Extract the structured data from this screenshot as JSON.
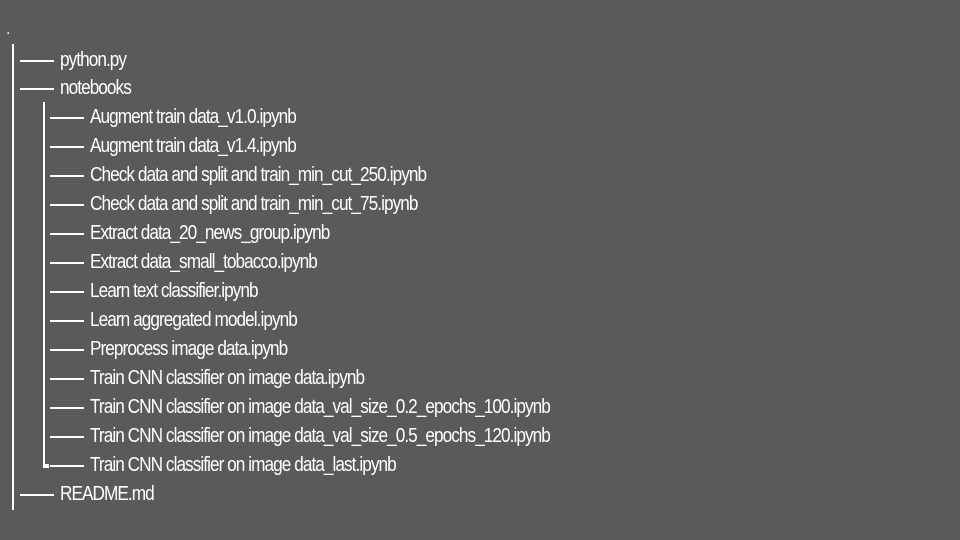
{
  "tree": {
    "root": ".",
    "top_items": [
      {
        "label": "python.py"
      },
      {
        "label": "notebooks"
      }
    ],
    "notebooks": [
      {
        "label": "Augment train data_v1.0.ipynb"
      },
      {
        "label": "Augment train data_v1.4.ipynb"
      },
      {
        "label": "Check data and split and train_min_cut_250.ipynb"
      },
      {
        "label": "Check data and split and train_min_cut_75.ipynb"
      },
      {
        "label": "Extract data_20_news_group.ipynb"
      },
      {
        "label": "Extract data_small_tobacco.ipynb"
      },
      {
        "label": "Learn text classifier.ipynb"
      },
      {
        "label": "Learn aggregated model.ipynb"
      },
      {
        "label": "Preprocess image data.ipynb"
      },
      {
        "label": "Train CNN classifier on image data.ipynb"
      },
      {
        "label": "Train CNN classifier on image data_val_size_0.2_epochs_100.ipynb"
      },
      {
        "label": "Train CNN classifier on image data_val_size_0.5_epochs_120.ipynb"
      },
      {
        "label": "Train CNN classifier on image data_last.ipynb"
      }
    ],
    "readme": {
      "label": "README.md"
    }
  }
}
